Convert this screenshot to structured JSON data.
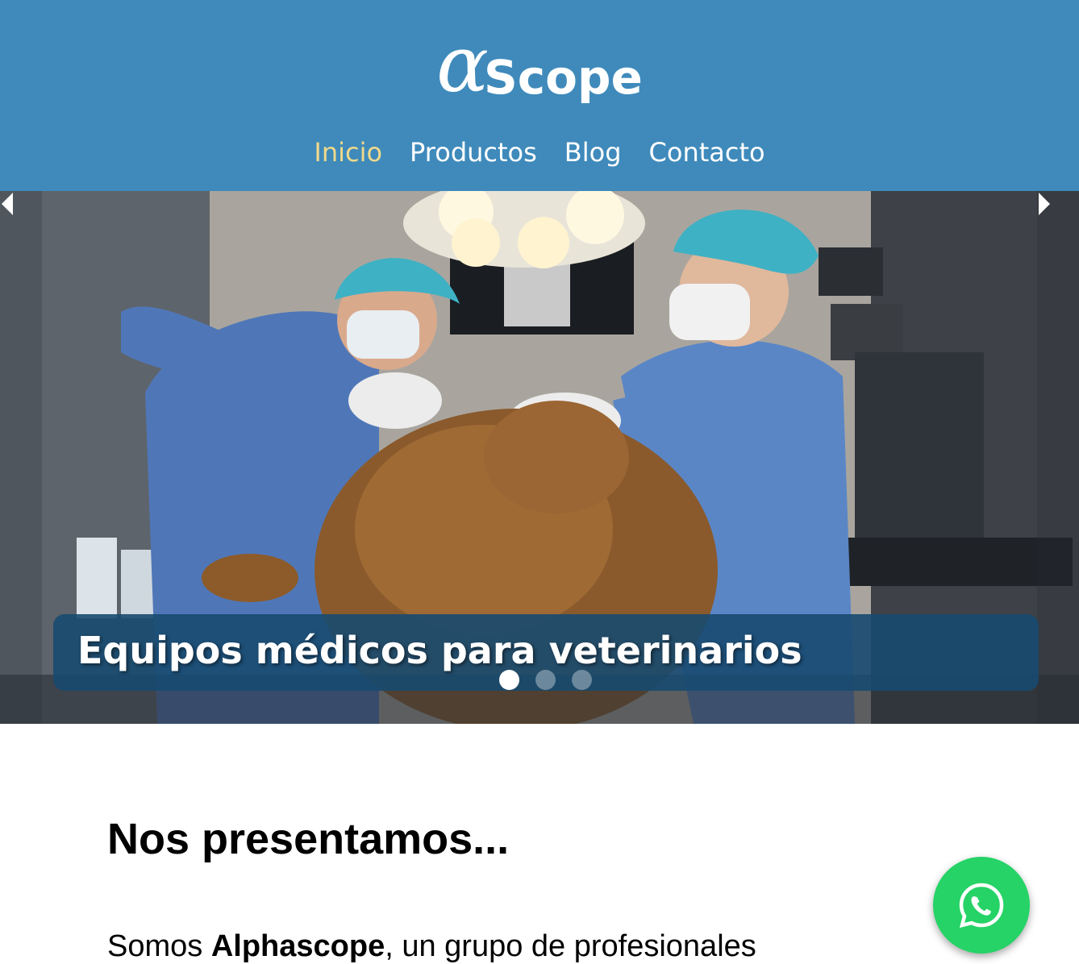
{
  "brand": {
    "alpha": "α",
    "word": "Scope"
  },
  "nav": [
    {
      "label": "Inicio",
      "active": true
    },
    {
      "label": "Productos",
      "active": false
    },
    {
      "label": "Blog",
      "active": false
    },
    {
      "label": "Contacto",
      "active": false
    }
  ],
  "colors": {
    "header": "#3f8abb",
    "nav_active": "#f0d98a",
    "caption_bg": "#174a70",
    "whatsapp": "#25d366"
  },
  "hero": {
    "caption": "Equipos médicos para veterinarios",
    "slides": 3,
    "active_slide": 1,
    "prev_icon": "chevron-left-icon",
    "next_icon": "chevron-right-icon"
  },
  "intro": {
    "title": "Nos presentamos...",
    "text_before": "Somos ",
    "text_bold": "Alphascope",
    "text_after": ", un grupo de profesionales"
  },
  "floating": {
    "icon": "whatsapp-icon"
  }
}
